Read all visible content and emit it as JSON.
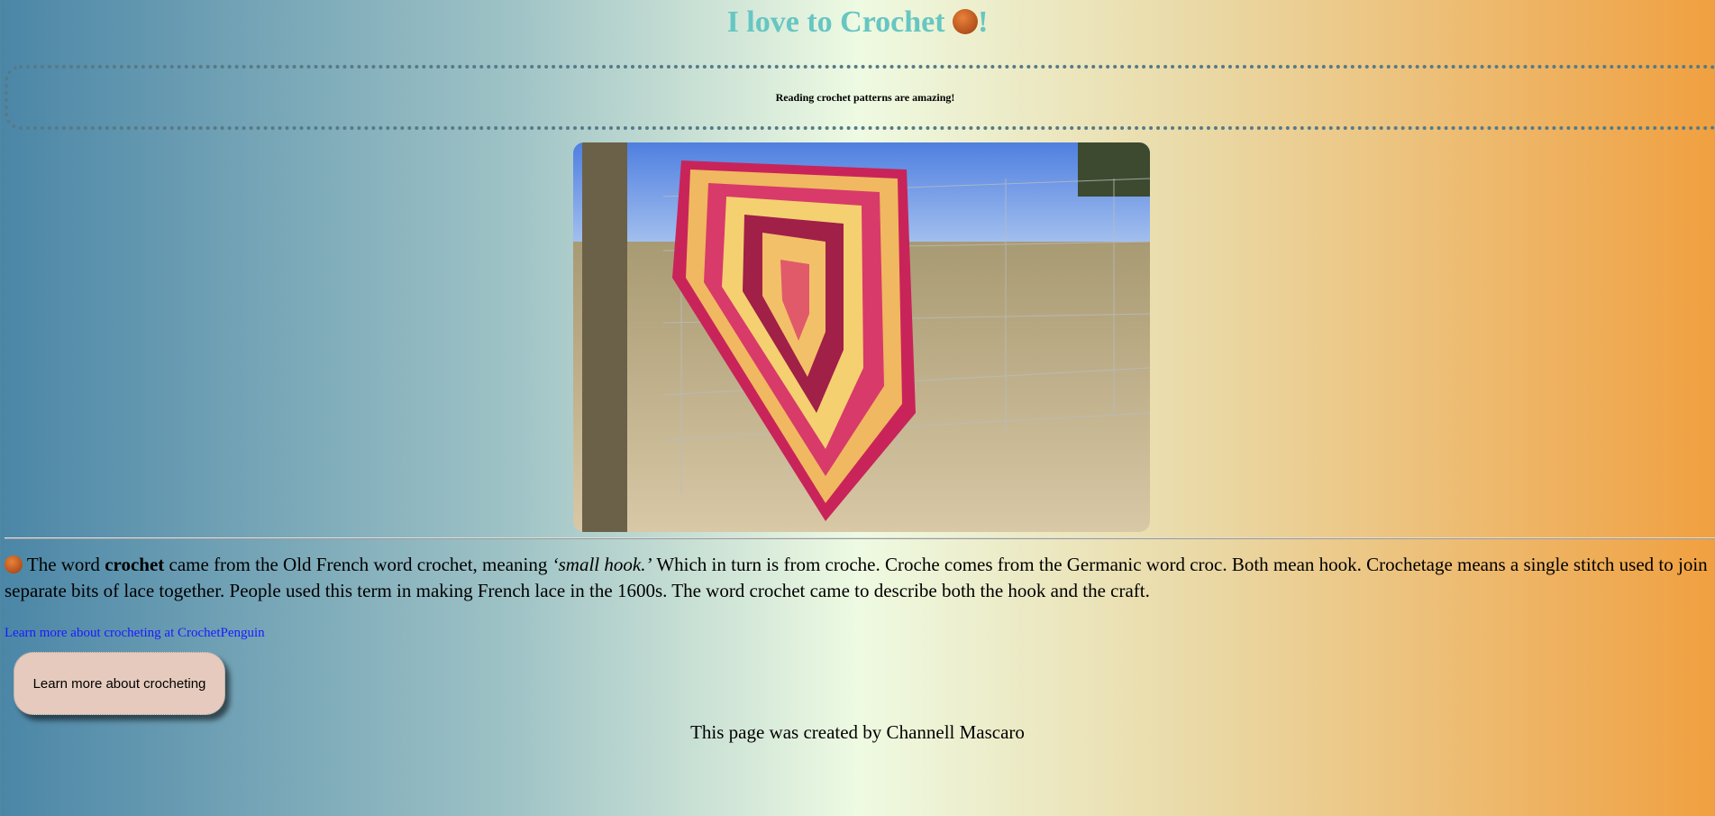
{
  "header": {
    "title": "I love to Crochet",
    "title_suffix": "!",
    "icon": "yarn-ball-icon",
    "title_color": "#66c6c2"
  },
  "banner": {
    "text": "Reading crochet patterns are amazing!"
  },
  "image": {
    "alt": "Crochet blanket draped over a farm gate"
  },
  "paragraph": {
    "icon": "yarn-ball-icon",
    "t1": " The word ",
    "bold": "crochet",
    "t2": " came from the Old French word crochet, meaning ",
    "italic": "‘small hook.’",
    "t3": " Which in turn is from croche. Croche comes from the Germanic word croc. Both mean hook. Crochetage means a single stitch used to join separate bits of lace together. People used this term in making French lace in the 1600s. The word crochet came to describe both the hook and the craft."
  },
  "link": {
    "text": "Learn more about crocheting at CrochetPenguin"
  },
  "button": {
    "label": "Learn more about crocheting"
  },
  "footer": {
    "text": "This page was created by Channell Mascaro"
  }
}
